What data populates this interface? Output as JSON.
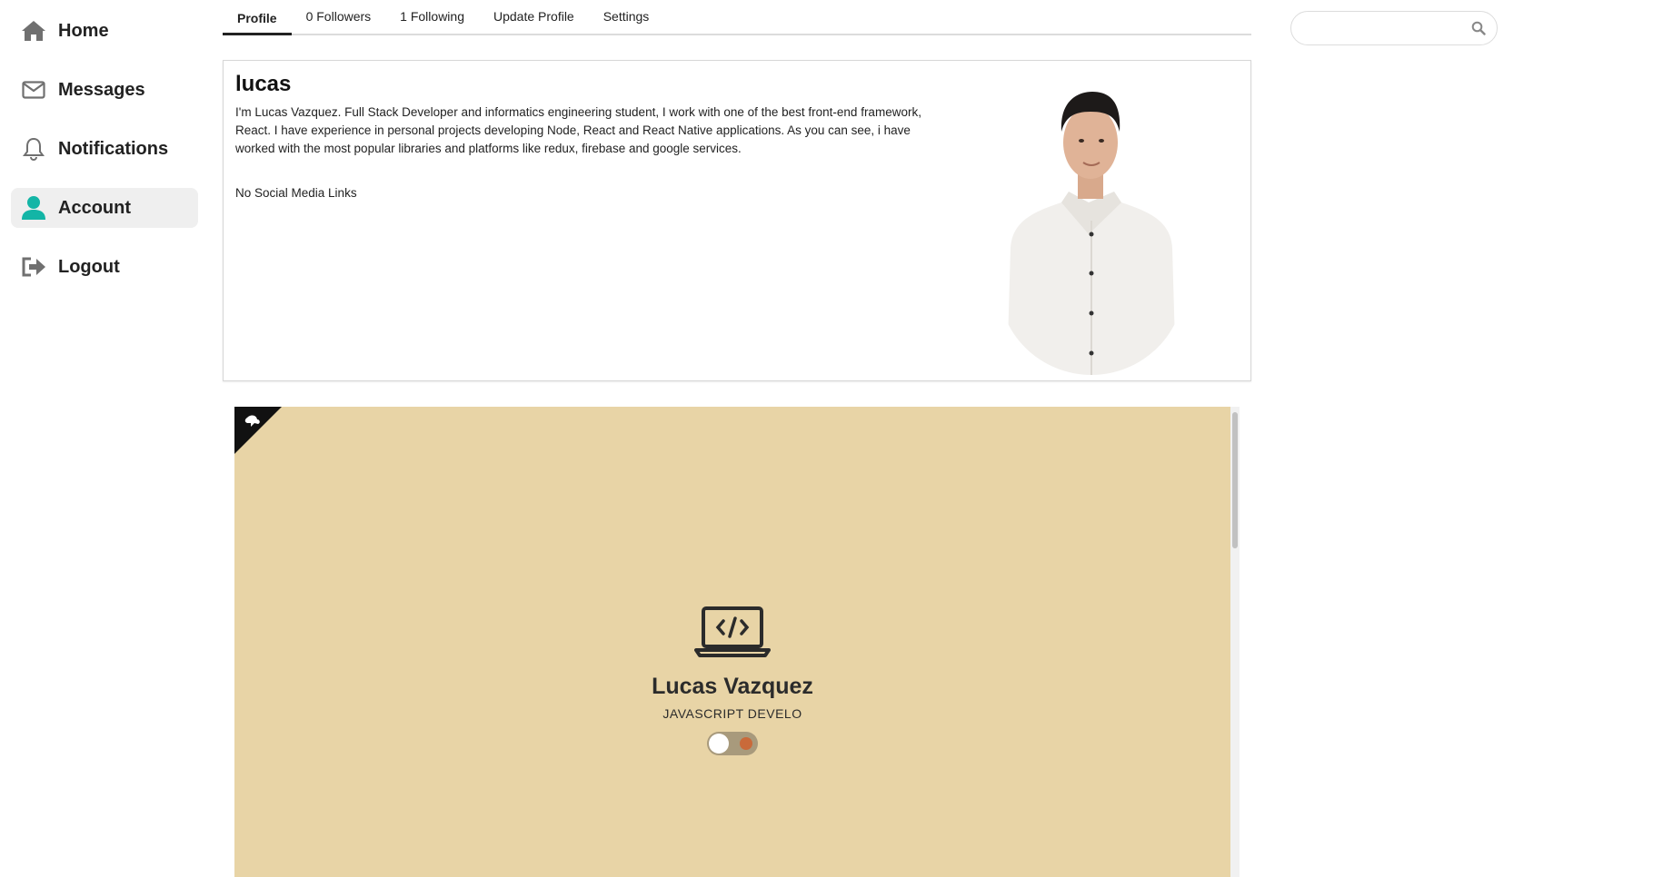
{
  "sidebar": {
    "items": [
      {
        "label": "Home",
        "icon": "home-icon"
      },
      {
        "label": "Messages",
        "icon": "envelope-icon"
      },
      {
        "label": "Notifications",
        "icon": "bell-icon"
      },
      {
        "label": "Account",
        "icon": "user-icon",
        "active": true
      },
      {
        "label": "Logout",
        "icon": "logout-icon"
      }
    ],
    "accent_color": "#13b5a6"
  },
  "tabs": [
    {
      "label": "Profile",
      "active": true
    },
    {
      "label": "0 Followers"
    },
    {
      "label": "1 Following"
    },
    {
      "label": "Update Profile"
    },
    {
      "label": "Settings"
    }
  ],
  "search": {
    "placeholder": "",
    "icon": "search-icon"
  },
  "profile": {
    "username": "lucas",
    "bio": "I'm Lucas Vazquez. Full Stack Developer and informatics engineering student, I work with one of the best front-end framework, React. I have experience in personal projects developing Node, React and React Native applications. As you can see, i have worked with the most popular libraries and platforms like redux, firebase and google services.",
    "social_links": "No Social Media Links"
  },
  "portfolio": {
    "name": "Lucas Vazquez",
    "role": "JAVASCRIPT DEVELO",
    "background_color": "#e8d4a6"
  }
}
